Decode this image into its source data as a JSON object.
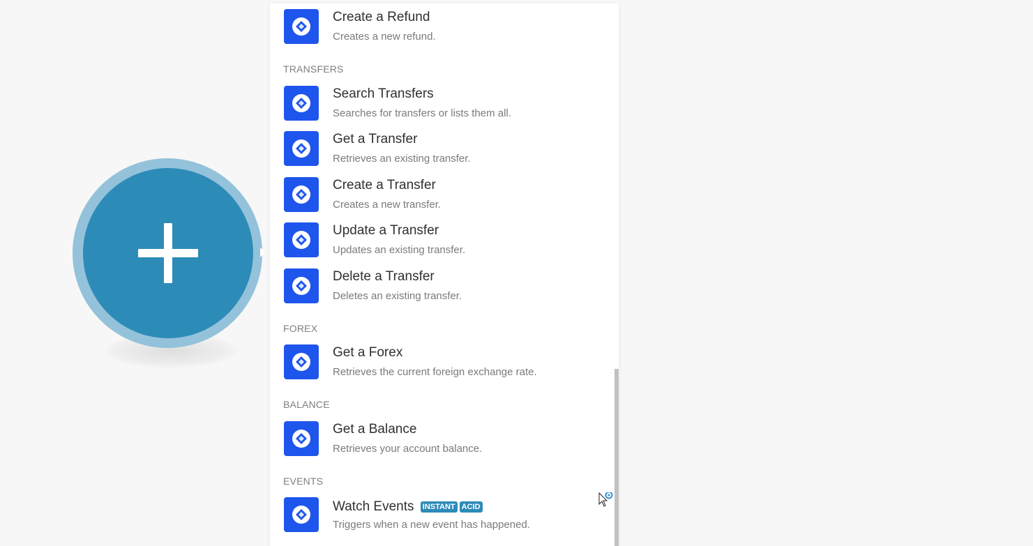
{
  "sections": [
    {
      "label": "TRANSFERS"
    },
    {
      "label": "FOREX"
    },
    {
      "label": "BALANCE"
    },
    {
      "label": "EVENTS"
    }
  ],
  "items": [
    {
      "title": "Create a Refund",
      "desc": "Creates a new refund."
    },
    {
      "title": "Search Transfers",
      "desc": "Searches for transfers or lists them all."
    },
    {
      "title": "Get a Transfer",
      "desc": "Retrieves an existing transfer."
    },
    {
      "title": "Create a Transfer",
      "desc": "Creates a new transfer."
    },
    {
      "title": "Update a Transfer",
      "desc": "Updates an existing transfer."
    },
    {
      "title": "Delete a Transfer",
      "desc": "Deletes an existing transfer."
    },
    {
      "title": "Get a Forex",
      "desc": "Retrieves the current foreign exchange rate."
    },
    {
      "title": "Get a Balance",
      "desc": "Retrieves your account balance."
    },
    {
      "title": "Watch Events",
      "desc": "Triggers when a new event has happened.",
      "badges": [
        "INSTANT",
        "ACID"
      ]
    }
  ],
  "icons": {
    "module_icon": "app-logo-icon",
    "add": "plus-icon",
    "cursor": "mouse-pointer-icon"
  },
  "colors": {
    "accent": "#2d8bb8",
    "app_icon": "#1e55ec",
    "ring": "#93c2da"
  }
}
